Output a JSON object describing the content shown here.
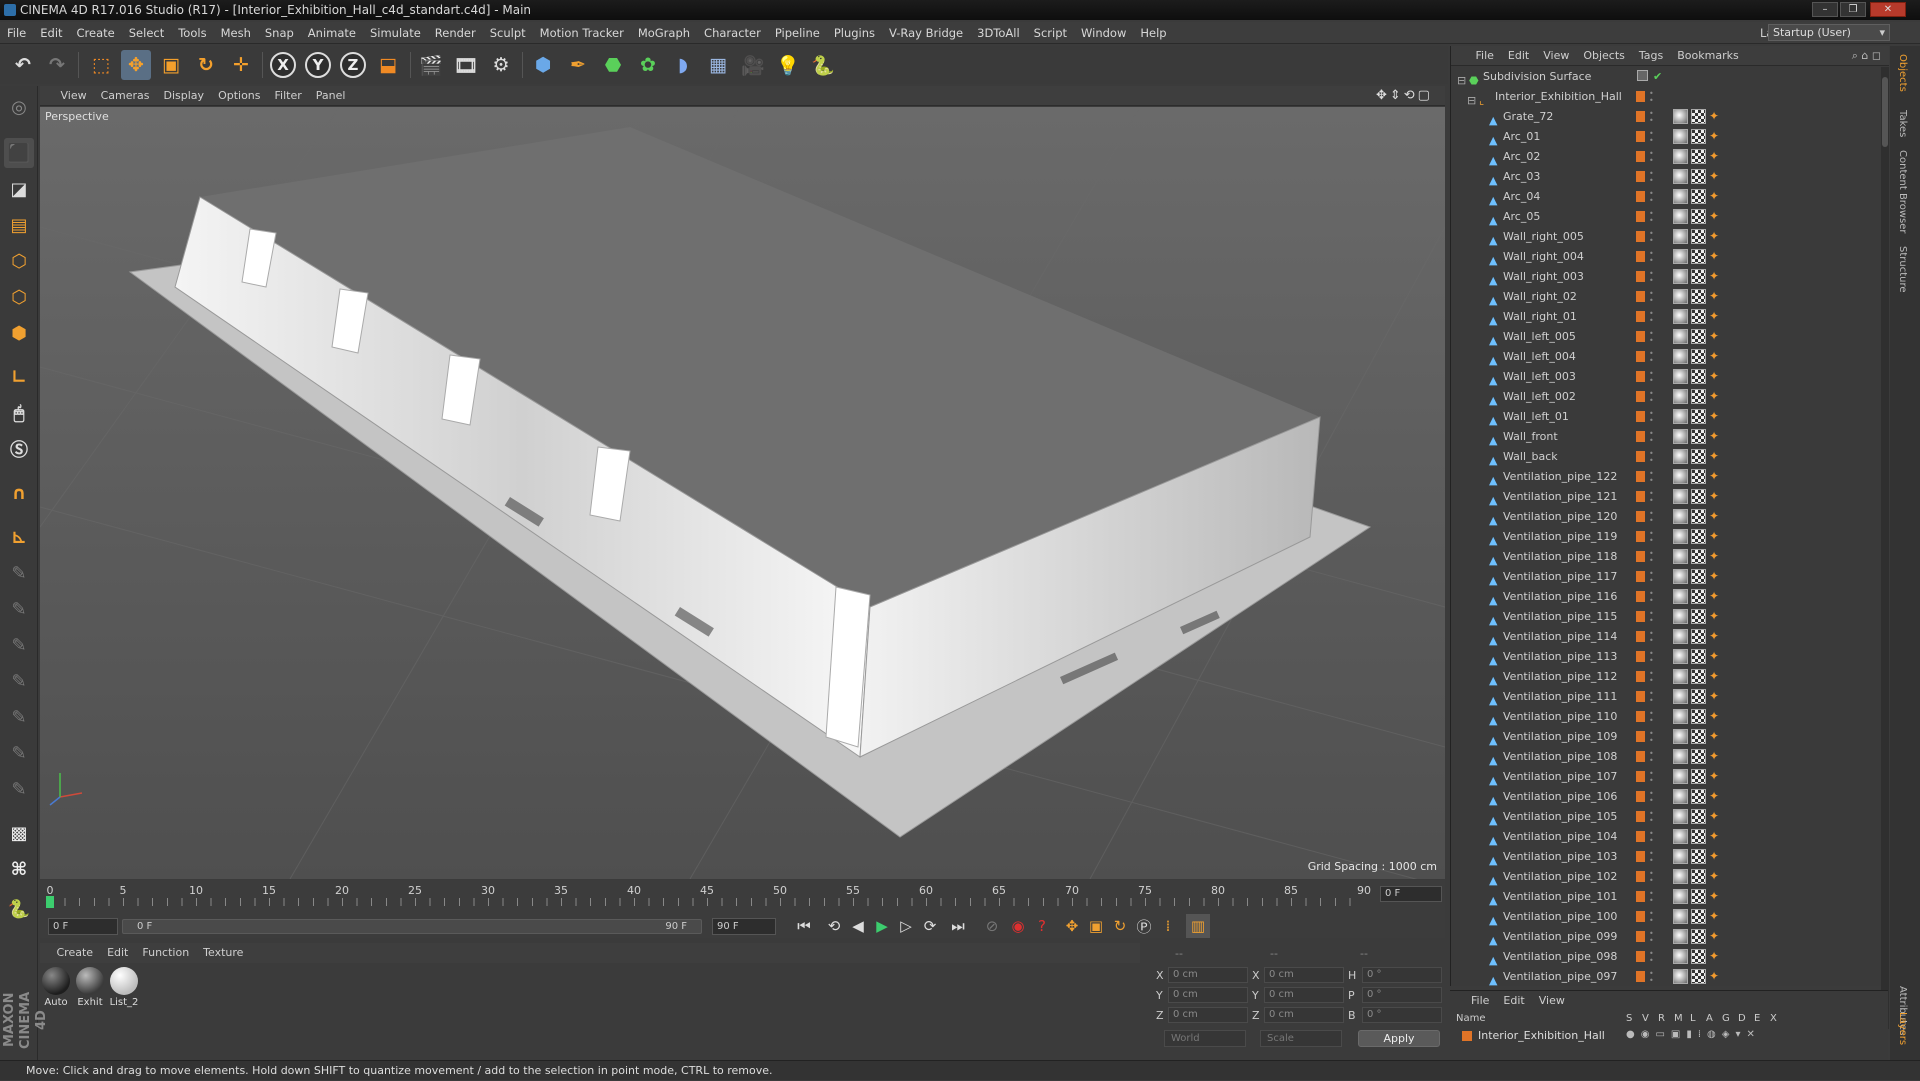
{
  "window": {
    "title": "CINEMA 4D R17.016 Studio (R17) - [Interior_Exhibition_Hall_c4d_standart.c4d] - Main",
    "controls": [
      "–",
      "❐",
      "✕"
    ]
  },
  "menu": [
    "File",
    "Edit",
    "Create",
    "Select",
    "Tools",
    "Mesh",
    "Snap",
    "Animate",
    "Simulate",
    "Render",
    "Sculpt",
    "Motion Tracker",
    "MoGraph",
    "Character",
    "Pipeline",
    "Plugins",
    "V-Ray Bridge",
    "3DToAll",
    "Script",
    "Window",
    "Help"
  ],
  "layout": {
    "label": "Layout:",
    "value": "Startup (User)"
  },
  "toolbar": {
    "axes": [
      "X",
      "Y",
      "Z"
    ]
  },
  "viewport": {
    "menu": [
      "View",
      "Cameras",
      "Display",
      "Options",
      "Filter",
      "Panel"
    ],
    "camera_label": "Perspective",
    "grid_spacing": "Grid Spacing : 1000 cm"
  },
  "timeline": {
    "ticks": [
      "0",
      "5",
      "10",
      "15",
      "20",
      "25",
      "30",
      "35",
      "40",
      "45",
      "50",
      "55",
      "60",
      "65",
      "70",
      "75",
      "80",
      "85",
      "90"
    ],
    "current_frame": "0 F",
    "start_field": "0 F",
    "range_start": "0 F",
    "range_end": "90 F",
    "end_field": "90 F"
  },
  "materials": {
    "menu": [
      "Create",
      "Edit",
      "Function",
      "Texture"
    ],
    "items": [
      {
        "label": "Auto",
        "color": "#1e1e1e"
      },
      {
        "label": "Exhit",
        "color": "#3a3a3a"
      },
      {
        "label": "List_2",
        "color": "#e8e8e8"
      }
    ]
  },
  "coords": {
    "header": [
      "--",
      "--",
      "--"
    ],
    "rows": [
      {
        "a": "X",
        "av": "0 cm",
        "b": "X",
        "bv": "0 cm",
        "c": "H",
        "cv": "0 °"
      },
      {
        "a": "Y",
        "av": "0 cm",
        "b": "Y",
        "bv": "0 cm",
        "c": "P",
        "cv": "0 °"
      },
      {
        "a": "Z",
        "av": "0 cm",
        "b": "Z",
        "bv": "0 cm",
        "c": "B",
        "cv": "0 °"
      }
    ],
    "mode": "World",
    "transform": "Scale",
    "apply": "Apply"
  },
  "brand": "MAXON CINEMA 4D",
  "status": "Move: Click and drag to move elements. Hold down SHIFT to quantize movement / add to the selection in point mode, CTRL to remove.",
  "objects": {
    "menu": [
      "File",
      "Edit",
      "View",
      "Objects",
      "Tags",
      "Bookmarks"
    ],
    "root": "Subdivision Surface",
    "group": "Interior_Exhibition_Hall",
    "children": [
      "Grate_72",
      "Arc_01",
      "Arc_02",
      "Arc_03",
      "Arc_04",
      "Arc_05",
      "Wall_right_005",
      "Wall_right_004",
      "Wall_right_003",
      "Wall_right_02",
      "Wall_right_01",
      "Wall_left_005",
      "Wall_left_004",
      "Wall_left_003",
      "Wall_left_002",
      "Wall_left_01",
      "Wall_front",
      "Wall_back",
      "Ventilation_pipe_122",
      "Ventilation_pipe_121",
      "Ventilation_pipe_120",
      "Ventilation_pipe_119",
      "Ventilation_pipe_118",
      "Ventilation_pipe_117",
      "Ventilation_pipe_116",
      "Ventilation_pipe_115",
      "Ventilation_pipe_114",
      "Ventilation_pipe_113",
      "Ventilation_pipe_112",
      "Ventilation_pipe_111",
      "Ventilation_pipe_110",
      "Ventilation_pipe_109",
      "Ventilation_pipe_108",
      "Ventilation_pipe_107",
      "Ventilation_pipe_106",
      "Ventilation_pipe_105",
      "Ventilation_pipe_104",
      "Ventilation_pipe_103",
      "Ventilation_pipe_102",
      "Ventilation_pipe_101",
      "Ventilation_pipe_100",
      "Ventilation_pipe_099",
      "Ventilation_pipe_098",
      "Ventilation_pipe_097"
    ]
  },
  "layers": {
    "menu": [
      "File",
      "Edit",
      "View"
    ],
    "columns": [
      "Name",
      "S",
      "V",
      "R",
      "M",
      "L",
      "A",
      "G",
      "D",
      "E",
      "X"
    ],
    "row": "Interior_Exhibition_Hall",
    "row_color": "#e07427"
  },
  "side_tabs": [
    "Objects",
    "Takes",
    "Content Browser",
    "Structure",
    "Attributes",
    "Layers"
  ]
}
